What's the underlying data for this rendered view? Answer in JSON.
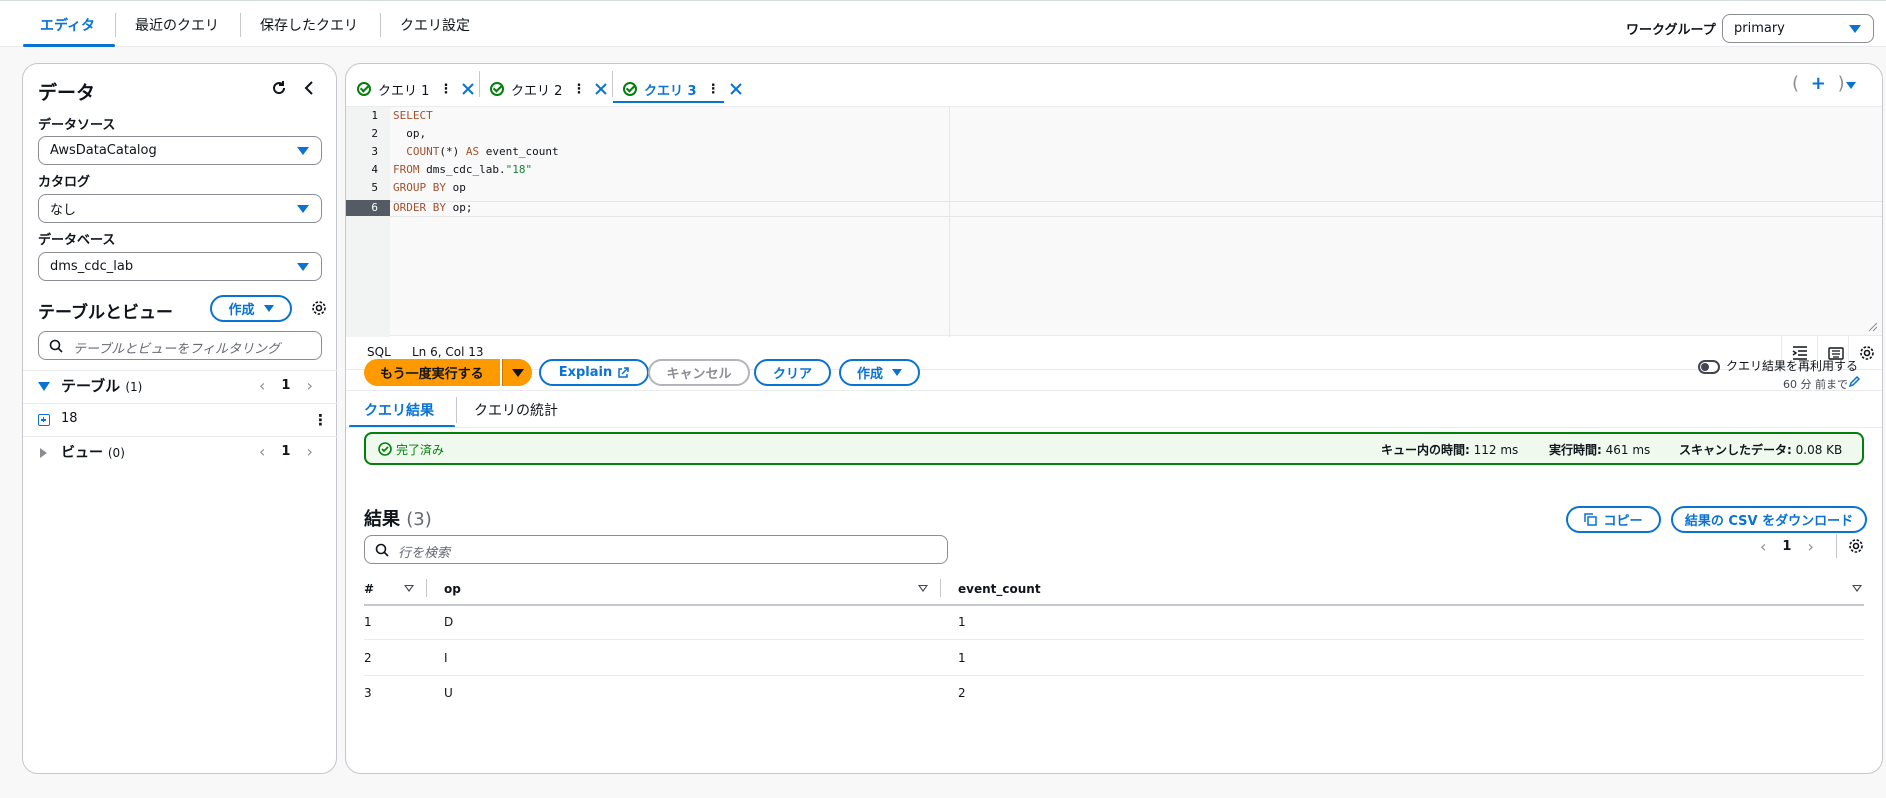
{
  "top_tabs": [
    "エディタ",
    "最近のクエリ",
    "保存したクエリ",
    "クエリ設定"
  ],
  "workgroup": {
    "label": "ワークグループ",
    "value": "primary"
  },
  "left": {
    "title": "データ",
    "datasource_label": "データソース",
    "datasource_value": "AwsDataCatalog",
    "catalog_label": "カタログ",
    "catalog_value": "なし",
    "database_label": "データベース",
    "database_value": "dms_cdc_lab",
    "tables_views_title": "テーブルとビュー",
    "create_label": "作成",
    "filter_placeholder": "テーブルとビューをフィルタリング",
    "tables_label": "テーブル",
    "tables_count": "(1)",
    "tables_page": "1",
    "table_item": "18",
    "views_label": "ビュー",
    "views_count": "(0)",
    "views_page": "1"
  },
  "query_tabs": [
    "クエリ 1",
    "クエリ 2",
    "クエリ 3"
  ],
  "editor": {
    "line_numbers": [
      "1",
      "2",
      "3",
      "4",
      "5",
      "6"
    ],
    "status_lang": "SQL",
    "status_pos": "Ln 6, Col 13"
  },
  "actions": {
    "run_again": "もう一度実行する",
    "explain": "Explain",
    "cancel": "キャンセル",
    "clear": "クリア",
    "create": "作成",
    "reuse_label": "クエリ結果を再利用する",
    "reuse_sub": "60 分 前まで"
  },
  "results_tabs": [
    "クエリ結果",
    "クエリの統計"
  ],
  "status": {
    "state": "完了済み",
    "queue_label": "キュー内の時間:",
    "queue_value": "112 ms",
    "exec_label": "実行時間:",
    "exec_value": "461 ms",
    "scan_label": "スキャンしたデータ:",
    "scan_value": "0.08 KB"
  },
  "results": {
    "title": "結果",
    "count": "(3)",
    "copy": "コピー",
    "download": "結果の CSV をダウンロード",
    "search_placeholder": "行を検索",
    "page": "1",
    "columns": [
      "#",
      "op",
      "event_count"
    ],
    "rows": [
      [
        "1",
        "D",
        "1"
      ],
      [
        "2",
        "I",
        "1"
      ],
      [
        "3",
        "U",
        "2"
      ]
    ]
  },
  "colors": {
    "accent": "#0972d3",
    "run": "#ff9900",
    "success": "#037f0c"
  }
}
